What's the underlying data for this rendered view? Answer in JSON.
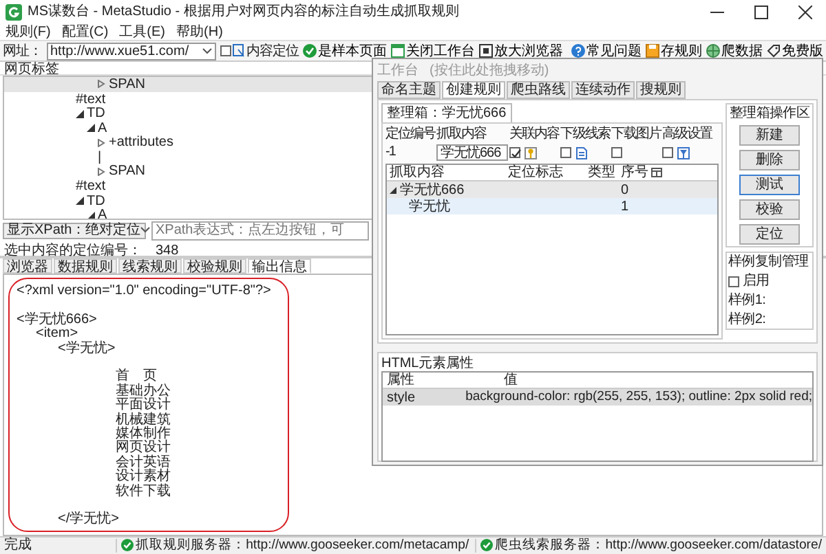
{
  "window": {
    "title": "MS谋数台 - MetaStudio - 根据用户对网页内容的标注自动生成抓取规则"
  },
  "menu": [
    {
      "label": "规则(F)"
    },
    {
      "label": "配置(C)"
    },
    {
      "label": "工具(E)"
    },
    {
      "label": "帮助(H)"
    }
  ],
  "toolbar": {
    "address_label": "网址：",
    "address": "http://www.xue51.com/",
    "content_locate": {
      "label": "内容定位",
      "checked": false
    },
    "actions": [
      {
        "label": "是样本页面",
        "kind": "check"
      },
      {
        "label": "关闭工作台",
        "kind": "window"
      },
      {
        "label": "放大浏览器",
        "kind": "zoom"
      }
    ],
    "help_actions": [
      {
        "label": "常见问题",
        "kind": "help"
      },
      {
        "label": "存规则",
        "kind": "save"
      },
      {
        "label": "爬数据",
        "kind": "data"
      },
      {
        "label": "免费版",
        "kind": "tag"
      }
    ]
  },
  "tree_panel": {
    "title": "网页标签",
    "nodes": [
      {
        "children": [
          {
            "children": [
              {
                "label": "SPAN",
                "expanded": false,
                "selected": true
              }
            ]
          }
        ]
      },
      {
        "label": "#text",
        "selected": false
      },
      {
        "label": "TD",
        "expanded": true,
        "selected": false,
        "children": [
          {
            "label": "A",
            "expanded": true,
            "selected": false,
            "children": [
              {
                "label": "+attributes",
                "expanded": false,
                "selected": false
              },
              {
                "label": "|",
                "selected": false
              },
              {
                "label": "SPAN",
                "expanded": false,
                "selected": false
              }
            ]
          }
        ]
      },
      {
        "label": "#text",
        "selected": false
      },
      {
        "label": "TD",
        "expanded": true,
        "selected": false,
        "children": [
          {
            "label": "A",
            "expanded": true,
            "selected": false
          }
        ]
      }
    ]
  },
  "xpath": {
    "mode": "显示XPath：绝对定位",
    "placeholder": "XPath表达式：点左边按钮，可"
  },
  "selected_position": {
    "label": "选中内容的定位编号：",
    "value": "348"
  },
  "bottom_tabs": [
    {
      "label": "浏览器",
      "selected": false
    },
    {
      "label": "数据规则",
      "selected": false
    },
    {
      "label": "线索规则",
      "selected": false
    },
    {
      "label": "校验规则",
      "selected": false
    },
    {
      "label": "输出信息",
      "selected": true
    }
  ],
  "output": {
    "declaration": "<?xml version=\"1.0\" encoding=\"UTF-8\"?>",
    "root": "<学无忧666>",
    "item": "<item>",
    "element_open": "<学无忧>",
    "content": [
      "首　页",
      "基础办公",
      "平面设计",
      "机械建筑",
      "媒体制作",
      "网页设计",
      "会计英语",
      "设计素材",
      "软件下载"
    ],
    "element_close": "</学无忧>"
  },
  "workbench": {
    "title": "工作台",
    "hint": "(按住此处拖拽移动)",
    "tabs": [
      {
        "label": "命名主题",
        "selected": false
      },
      {
        "label": "创建规则",
        "selected": true
      },
      {
        "label": "爬虫路线",
        "selected": false
      },
      {
        "label": "连续动作",
        "selected": false
      },
      {
        "label": "搜规则",
        "selected": false
      }
    ],
    "box_tab": "整理箱：学无忧666",
    "position_label": "定位编号",
    "position_value": "-1",
    "content_label": "抓取内容",
    "content_value": "学无忧666",
    "options": [
      {
        "label": "关联内容",
        "checked": true,
        "kind": "key"
      },
      {
        "label": "下级线索",
        "checked": false,
        "kind": "doc"
      },
      {
        "label": "下载图片",
        "checked": false,
        "kind": "none"
      },
      {
        "label": "高级设置",
        "checked": false,
        "kind": "filter"
      }
    ],
    "columns": [
      "抓取内容",
      "定位标志",
      "类型",
      "序号"
    ],
    "rows": [
      {
        "content": "学无忧666",
        "index": "0",
        "expanded": true,
        "selected": false,
        "children": [
          {
            "content": "学无忧",
            "index": "1",
            "selected": true
          }
        ]
      }
    ],
    "actions_title": "整理箱操作区",
    "buttons": [
      {
        "label": "新建",
        "focused": false
      },
      {
        "label": "删除",
        "focused": false
      },
      {
        "label": "测试",
        "focused": true
      },
      {
        "label": "校验",
        "focused": false
      },
      {
        "label": "定位",
        "focused": false
      }
    ],
    "sample_title": "样例复制管理",
    "sample_enable": {
      "label": "启用",
      "checked": false
    },
    "samples": [
      "样例1:",
      "样例2:"
    ],
    "attributes": {
      "title": "HTML元素属性",
      "columns": [
        "属性",
        "值"
      ],
      "rows": [
        {
          "name": "style",
          "value": "background-color: rgb(255, 255, 153); outline: 2px solid red;",
          "selected": true
        }
      ]
    }
  },
  "status_bar": {
    "text": "完成",
    "servers": [
      {
        "label": "抓取规则服务器：http://www.gooseeker.com/metacamp/"
      },
      {
        "label": "爬虫线索服务器：http://www.gooseeker.com/datastore/"
      }
    ]
  }
}
